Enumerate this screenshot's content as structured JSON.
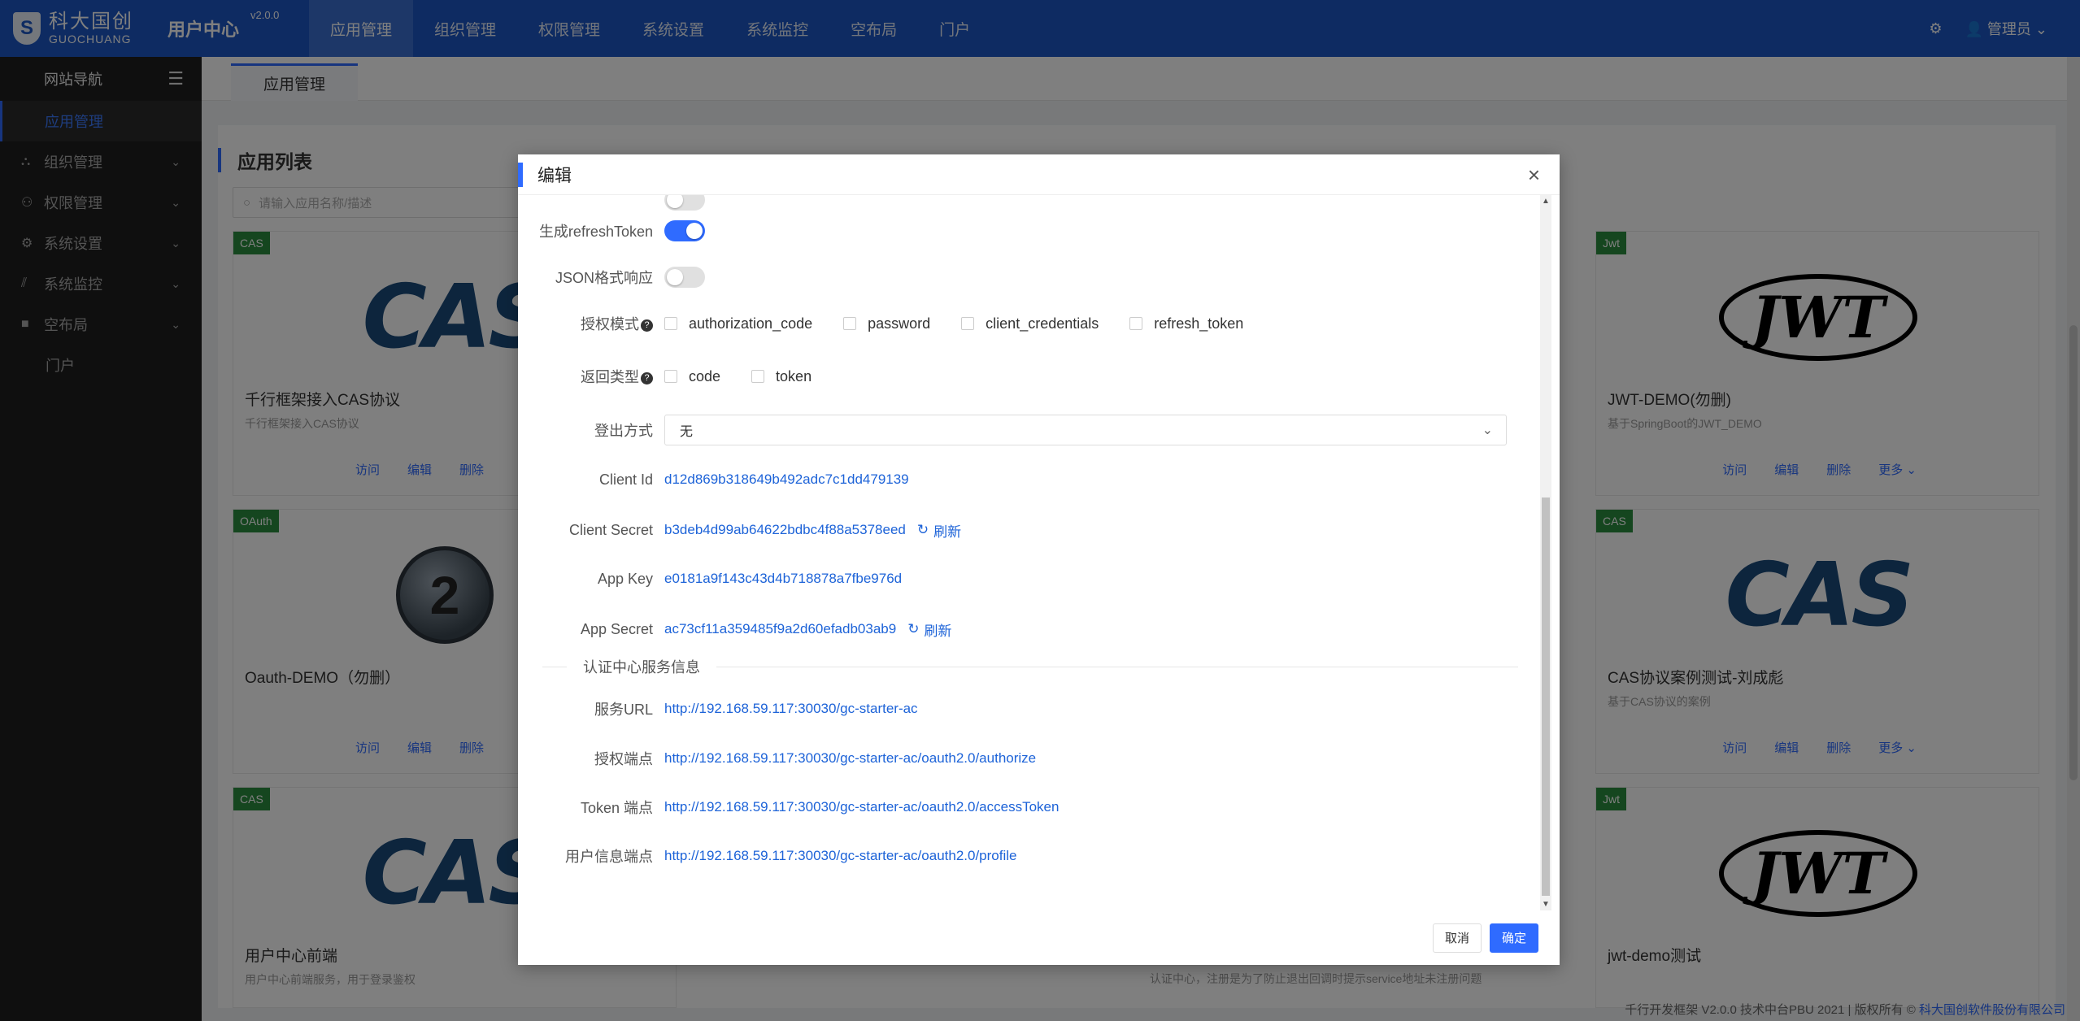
{
  "brand": {
    "name_cn": "科大国创",
    "name_en": "GUOCHUANG"
  },
  "app": {
    "title": "用户中心",
    "version": "v2.0.0"
  },
  "topnav": [
    "应用管理",
    "组织管理",
    "权限管理",
    "系统设置",
    "系统监控",
    "空布局",
    "门户"
  ],
  "user": {
    "name": "管理员"
  },
  "sidebar": {
    "header": "网站导航",
    "items": [
      {
        "label": "应用管理"
      },
      {
        "label": "组织管理"
      },
      {
        "label": "权限管理"
      },
      {
        "label": "系统设置"
      },
      {
        "label": "系统监控"
      },
      {
        "label": "空布局"
      },
      {
        "label": "门户"
      }
    ]
  },
  "tab": {
    "label": "应用管理"
  },
  "page": {
    "title": "应用列表",
    "search_placeholder": "请输入应用名称/描述"
  },
  "cards": [
    {
      "badge": "CAS",
      "logo": "CAS",
      "name": "千行框架接入CAS协议",
      "desc": "千行框架接入CAS协议"
    },
    {
      "badge": "Jwt",
      "logo": "JWT",
      "name": "JWT-DEMO(勿删)",
      "desc": "基于SpringBoot的JWT_DEMO"
    },
    {
      "badge": "OAuth",
      "logo": "2",
      "name": "Oauth-DEMO（勿删）",
      "desc": ""
    },
    {
      "badge": "CAS",
      "logo": "CAS",
      "name": "CAS协议案例测试-刘成彪",
      "desc": "基于CAS协议的案例"
    },
    {
      "badge": "CAS",
      "logo": "CAS",
      "name": "用户中心前端",
      "desc": "用户中心前端服务，用于登录鉴权"
    },
    {
      "badge": "Jwt",
      "logo": "JWT",
      "name": "jwt-demo测试",
      "desc": ""
    }
  ],
  "card_actions": {
    "visit": "访问",
    "edit": "编辑",
    "delete": "删除",
    "more": "更多"
  },
  "partial_desc": "认证中心，注册是为了防止退出回调时提示service地址未注册问题",
  "footer": {
    "text": "千行开发框架 V2.0.0 技术中台PBU 2021 | 版权所有 ©",
    "company": "科大国创软件股份有限公司"
  },
  "modal": {
    "title": "编辑",
    "fields": {
      "refresh_token_label": "生成refreshToken",
      "refresh_token_on": true,
      "json_label": "JSON格式响应",
      "json_on": false,
      "grant_label": "授权模式",
      "grant_options": [
        "authorization_code",
        "password",
        "client_credentials",
        "refresh_token"
      ],
      "response_label": "返回类型",
      "response_options": [
        "code",
        "token"
      ],
      "logout_label": "登出方式",
      "logout_value": "无",
      "client_id_label": "Client Id",
      "client_id": "d12d869b318649b492adc7c1dd479139",
      "client_secret_label": "Client Secret",
      "client_secret": "b3deb4d99ab64622bdbc4f88a5378eed",
      "app_key_label": "App Key",
      "app_key": "e0181a9f143c43d4b718878a7fbe976d",
      "app_secret_label": "App Secret",
      "app_secret": "ac73cf11a359485f9a2d60efadb03ab9",
      "refresh_text": "刷新"
    },
    "section_title": "认证中心服务信息",
    "service": {
      "url_label": "服务URL",
      "url": "http://192.168.59.117:30030/gc-starter-ac",
      "authorize_label": "授权端点",
      "authorize": "http://192.168.59.117:30030/gc-starter-ac/oauth2.0/authorize",
      "token_label": "Token 端点",
      "token": "http://192.168.59.117:30030/gc-starter-ac/oauth2.0/accessToken",
      "profile_label": "用户信息端点",
      "profile": "http://192.168.59.117:30030/gc-starter-ac/oauth2.0/profile"
    },
    "cancel": "取消",
    "ok": "确定"
  },
  "colors": {
    "primary": "#1c57c4",
    "accent": "#2f6bff",
    "badge_green": "#2a8c3e",
    "sidebar_bg": "#1f1f1f"
  }
}
